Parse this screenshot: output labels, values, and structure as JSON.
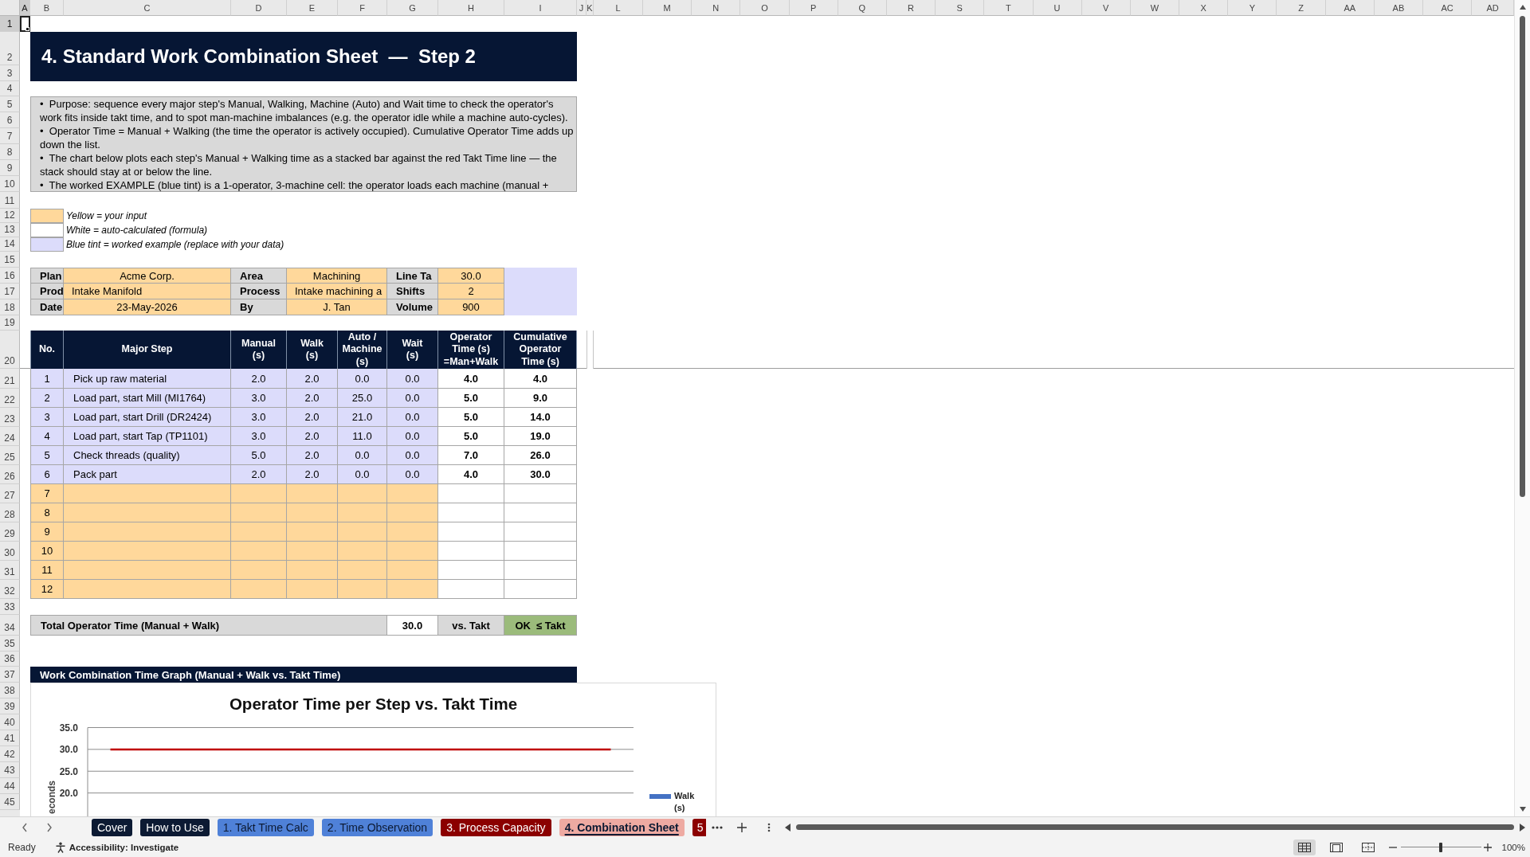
{
  "column_headers": [
    {
      "label": "A",
      "selected": true
    },
    {
      "label": "B",
      "selected": false
    },
    {
      "label": "C",
      "selected": false
    },
    {
      "label": "D",
      "selected": false
    },
    {
      "label": "E",
      "selected": false
    },
    {
      "label": "F",
      "selected": false
    },
    {
      "label": "G",
      "selected": false
    },
    {
      "label": "H",
      "selected": false
    },
    {
      "label": "I",
      "selected": false
    },
    {
      "label": "J",
      "selected": false
    },
    {
      "label": "K",
      "selected": false
    },
    {
      "label": "L",
      "selected": false
    },
    {
      "label": "M",
      "selected": false
    },
    {
      "label": "N",
      "selected": false
    },
    {
      "label": "O",
      "selected": false
    },
    {
      "label": "P",
      "selected": false
    },
    {
      "label": "Q",
      "selected": false
    },
    {
      "label": "R",
      "selected": false
    },
    {
      "label": "S",
      "selected": false
    },
    {
      "label": "T",
      "selected": false
    },
    {
      "label": "U",
      "selected": false
    },
    {
      "label": "V",
      "selected": false
    },
    {
      "label": "W",
      "selected": false
    },
    {
      "label": "X",
      "selected": false
    },
    {
      "label": "Y",
      "selected": false
    },
    {
      "label": "Z",
      "selected": false
    },
    {
      "label": "AA",
      "selected": false
    },
    {
      "label": "AB",
      "selected": false
    },
    {
      "label": "AC",
      "selected": false
    },
    {
      "label": "AD",
      "selected": false
    }
  ],
  "row_headers": [
    {
      "label": "1",
      "selected": true
    },
    {
      "label": "2",
      "selected": false
    },
    {
      "label": "3",
      "selected": false
    },
    {
      "label": "4",
      "selected": false
    },
    {
      "label": "5",
      "selected": false
    },
    {
      "label": "6",
      "selected": false
    },
    {
      "label": "7",
      "selected": false
    },
    {
      "label": "8",
      "selected": false
    },
    {
      "label": "9",
      "selected": false
    },
    {
      "label": "10",
      "selected": false
    },
    {
      "label": "11",
      "selected": false
    },
    {
      "label": "12",
      "selected": false
    },
    {
      "label": "13",
      "selected": false
    },
    {
      "label": "14",
      "selected": false
    },
    {
      "label": "15",
      "selected": false
    },
    {
      "label": "16",
      "selected": false
    },
    {
      "label": "17",
      "selected": false
    },
    {
      "label": "18",
      "selected": false
    },
    {
      "label": "19",
      "selected": false
    },
    {
      "label": "20",
      "selected": false
    },
    {
      "label": "21",
      "selected": false
    },
    {
      "label": "22",
      "selected": false
    },
    {
      "label": "23",
      "selected": false
    },
    {
      "label": "24",
      "selected": false
    },
    {
      "label": "25",
      "selected": false
    },
    {
      "label": "26",
      "selected": false
    },
    {
      "label": "27",
      "selected": false
    },
    {
      "label": "28",
      "selected": false
    },
    {
      "label": "29",
      "selected": false
    },
    {
      "label": "30",
      "selected": false
    },
    {
      "label": "31",
      "selected": false
    },
    {
      "label": "32",
      "selected": false
    },
    {
      "label": "33",
      "selected": false
    },
    {
      "label": "34",
      "selected": false
    },
    {
      "label": "35",
      "selected": false
    },
    {
      "label": "36",
      "selected": false
    },
    {
      "label": "37",
      "selected": false
    },
    {
      "label": "38",
      "selected": false
    },
    {
      "label": "39",
      "selected": false
    },
    {
      "label": "40",
      "selected": false
    },
    {
      "label": "41",
      "selected": false
    },
    {
      "label": "42",
      "selected": false
    },
    {
      "label": "43",
      "selected": false
    },
    {
      "label": "44",
      "selected": false
    },
    {
      "label": "45",
      "selected": false
    }
  ],
  "title": "4. Standard Work Combination Sheet  —  Step 2",
  "notes": [
    "•  Purpose: sequence every major step's Manual, Walking, Machine (Auto) and Wait time to check the operator's work fits inside takt time, and to spot man-machine imbalances (e.g. the operator idle while a machine auto-cycles).",
    "•  Operator Time = Manual + Walking (the time the operator is actively occupied). Cumulative Operator Time adds up down the list.",
    "•  The chart below plots each step's Manual + Walking time as a stacked bar against the red Takt Time line — the stack should stay at or below the line.",
    "•  The worked EXAMPLE (blue tint) is a 1-operator, 3-machine cell: the operator loads each machine (manual +"
  ],
  "legend": [
    {
      "label": "Yellow = your input",
      "color": "#ffd89b"
    },
    {
      "label": "White = auto-calculated (formula)",
      "color": "#ffffff"
    },
    {
      "label": "Blue tint = worked example (replace with your data)",
      "color": "#dcdcfb"
    }
  ],
  "info": [
    [
      {
        "label": "Plan",
        "value": "Acme Corp."
      },
      {
        "label": "Area",
        "value": "Machining"
      },
      {
        "label": "Line Ta",
        "value": "30.0"
      }
    ],
    [
      {
        "label": "Prod",
        "value": "Intake Manifold"
      },
      {
        "label": "Process",
        "value": "Intake machining a"
      },
      {
        "label": "Shifts",
        "value": "2"
      }
    ],
    [
      {
        "label": "Date",
        "value": "23-May-2026"
      },
      {
        "label": "By",
        "value": "J. Tan"
      },
      {
        "label": "Volume",
        "value": "900"
      }
    ]
  ],
  "table": {
    "columns": [
      "No.",
      "Major Step",
      "Manual\n(s)",
      "Walk\n(s)",
      "Auto /\nMachine\n(s)",
      "Wait\n(s)",
      "Operator\nTime (s)\n=Man+Walk",
      "Cumulative\nOperator\nTime (s)"
    ],
    "rows": [
      {
        "kind": "example",
        "no": "1",
        "step": "Pick up raw material",
        "manual": "2.0",
        "walk": "2.0",
        "auto": "0.0",
        "wait": "0.0",
        "operator_time": "4.0",
        "cumulative": "4.0"
      },
      {
        "kind": "example",
        "no": "2",
        "step": "Load part, start Mill (MI1764)",
        "manual": "3.0",
        "walk": "2.0",
        "auto": "25.0",
        "wait": "0.0",
        "operator_time": "5.0",
        "cumulative": "9.0"
      },
      {
        "kind": "example",
        "no": "3",
        "step": "Load part, start Drill (DR2424)",
        "manual": "3.0",
        "walk": "2.0",
        "auto": "21.0",
        "wait": "0.0",
        "operator_time": "5.0",
        "cumulative": "14.0"
      },
      {
        "kind": "example",
        "no": "4",
        "step": "Load part, start Tap (TP1101)",
        "manual": "3.0",
        "walk": "2.0",
        "auto": "11.0",
        "wait": "0.0",
        "operator_time": "5.0",
        "cumulative": "19.0"
      },
      {
        "kind": "example",
        "no": "5",
        "step": "Check threads (quality)",
        "manual": "5.0",
        "walk": "2.0",
        "auto": "0.0",
        "wait": "0.0",
        "operator_time": "7.0",
        "cumulative": "26.0"
      },
      {
        "kind": "example",
        "no": "6",
        "step": "Pack part",
        "manual": "2.0",
        "walk": "2.0",
        "auto": "0.0",
        "wait": "0.0",
        "operator_time": "4.0",
        "cumulative": "30.0"
      },
      {
        "kind": "input",
        "no": "7"
      },
      {
        "kind": "input",
        "no": "8"
      },
      {
        "kind": "input",
        "no": "9"
      },
      {
        "kind": "input",
        "no": "10"
      },
      {
        "kind": "input",
        "no": "11"
      },
      {
        "kind": "input",
        "no": "12"
      }
    ]
  },
  "total": {
    "label": "Total Operator Time (Manual + Walk)",
    "value": "30.0",
    "comparison": "vs. Takt",
    "verdict": "OK  ≤ Takt",
    "kind": "ok"
  },
  "graph_section": {
    "title": "Work Combination Time Graph (Manual + Walk vs. Takt Time)",
    "chart_data": {
      "type": "bar",
      "title": "Operator Time per Step vs. Takt Time",
      "ylabel": "econds",
      "ylim": [
        15,
        35
      ],
      "yticks": [
        {
          "value": 20,
          "label": "20.0"
        },
        {
          "value": 25,
          "label": "25.0"
        },
        {
          "value": 30,
          "label": "30.0"
        },
        {
          "value": 35,
          "label": "35.0"
        }
      ],
      "grid": true,
      "series": [
        {
          "name": "Walk (s)",
          "color": "#4472c4"
        }
      ],
      "ref_lines": [
        {
          "axis": "y",
          "value": 30,
          "color": "#c00000"
        }
      ]
    }
  },
  "sheet_tabs": [
    {
      "label": "Cover",
      "color": "#0c1a33",
      "selected": false
    },
    {
      "label": "How to Use",
      "color": "#0c1a33",
      "selected": false
    },
    {
      "label": "1. Takt Time Calc",
      "color": "#4f81d8",
      "selected": false
    },
    {
      "label": "2. Time Observation",
      "color": "#4f81d8",
      "selected": false
    },
    {
      "label": "3. Process Capacity",
      "color": "#8b0000",
      "selected": false
    },
    {
      "label": "4. Combination Sheet",
      "color": "#eeaaa2",
      "selected": true
    },
    {
      "label": "5",
      "color": "#8b0000",
      "selected": false
    }
  ],
  "status_bar": {
    "ready": "Ready",
    "accessibility": "Accessibility: Investigate",
    "views": [
      {
        "kind": "normal",
        "selected": true
      },
      {
        "kind": "page_layout",
        "selected": false
      },
      {
        "kind": "page_break",
        "selected": false
      }
    ],
    "zoom": {
      "level": 0.5,
      "reading": "100%"
    }
  }
}
